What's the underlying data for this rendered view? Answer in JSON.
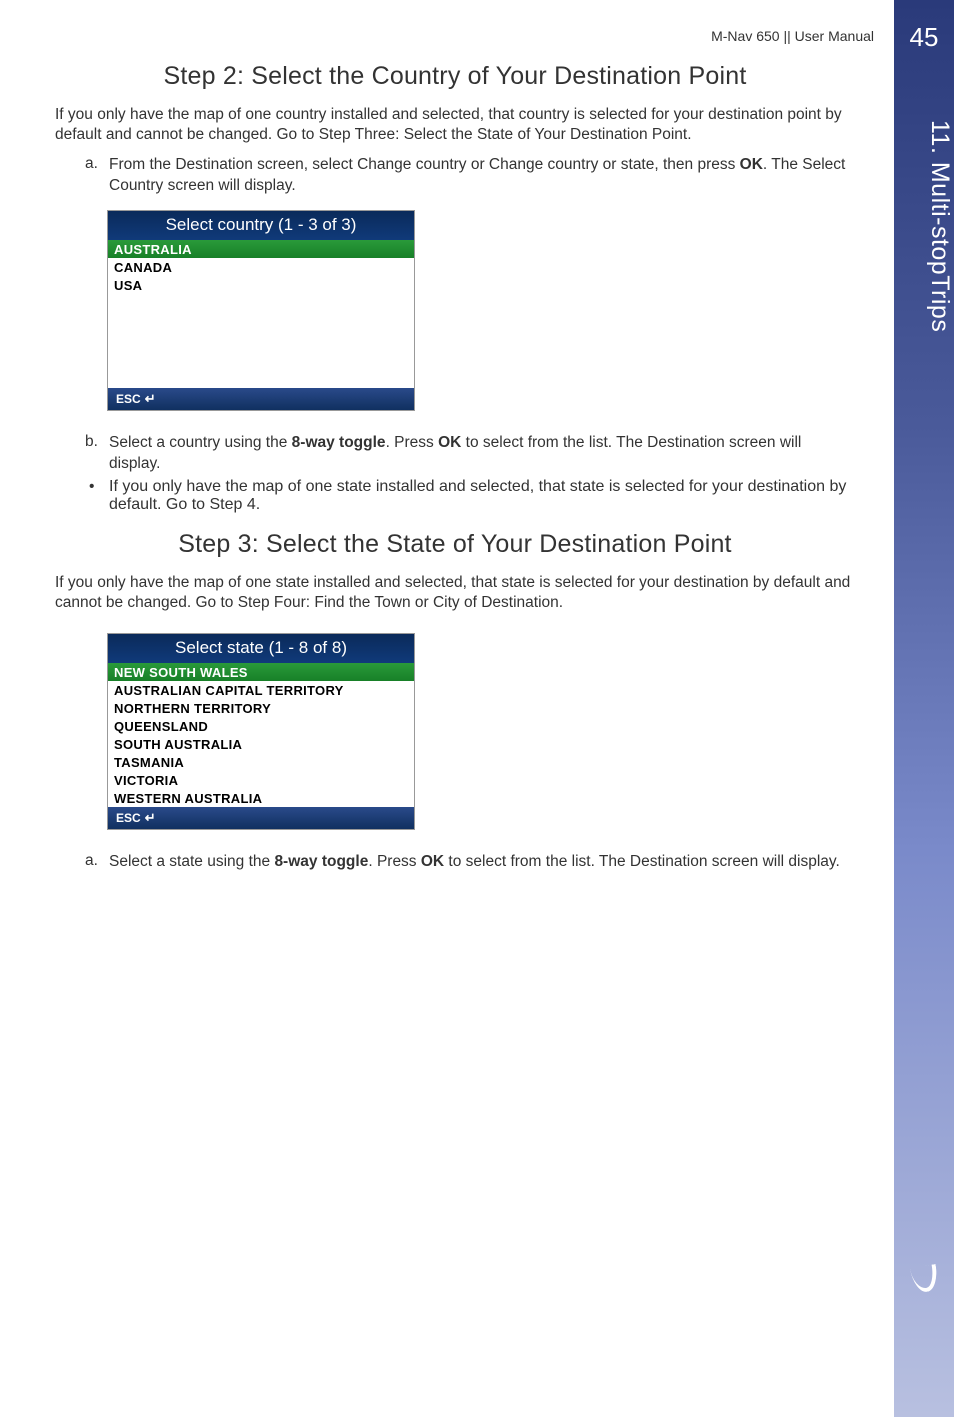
{
  "page_number": "45",
  "sidebar_label": "11. Multi-stopTrips",
  "header": "M-Nav 650 || User Manual",
  "step2": {
    "title": "Step 2: Select the Country of Your Destination Point",
    "intro": "If you only have the map of one country installed and selected, that country is selected for your destination point by default and cannot be changed. Go to Step Three: Select the State of Your Destination Point.",
    "item_a_prefix": "a.",
    "item_a_1": "From the Destination screen, select Change country or Change country or state, then press ",
    "item_a_bold": "OK",
    "item_a_2": ". The Select Country screen will display.",
    "screen": {
      "title": "Select country (1 - 3 of 3)",
      "rows": [
        "AUSTRALIA",
        "CANADA",
        "USA"
      ],
      "selected_index": 0,
      "footer": "ESC"
    },
    "item_b_prefix": "b.",
    "item_b_1": "Select a country using the ",
    "item_b_bold1": "8-way toggle",
    "item_b_2": ". Press ",
    "item_b_bold2": "OK",
    "item_b_3": " to select from the list. The Destination screen will display.",
    "bullet_prefix": "•",
    "bullet_text": "If you only have the map of one state installed and selected, that state is selected for your destination by default. Go to Step 4."
  },
  "step3": {
    "title": "Step 3: Select the State of Your Destination Point",
    "intro": "If you only have the map of one state installed and selected, that state is selected for your destination by default and cannot be changed. Go to Step Four: Find the Town or City of Destination.",
    "screen": {
      "title": "Select state (1 - 8 of 8)",
      "rows": [
        "NEW SOUTH WALES",
        "AUSTRALIAN CAPITAL TERRITORY",
        "NORTHERN TERRITORY",
        "QUEENSLAND",
        "SOUTH AUSTRALIA",
        "TASMANIA",
        "VICTORIA",
        "WESTERN AUSTRALIA"
      ],
      "selected_index": 0,
      "footer": "ESC"
    },
    "item_a_prefix": "a.",
    "item_a_1": "Select a state using the ",
    "item_a_bold1": "8-way toggle",
    "item_a_2": ". Press ",
    "item_a_bold2": "OK",
    "item_a_3": " to select from the list. The Destination screen will display."
  }
}
